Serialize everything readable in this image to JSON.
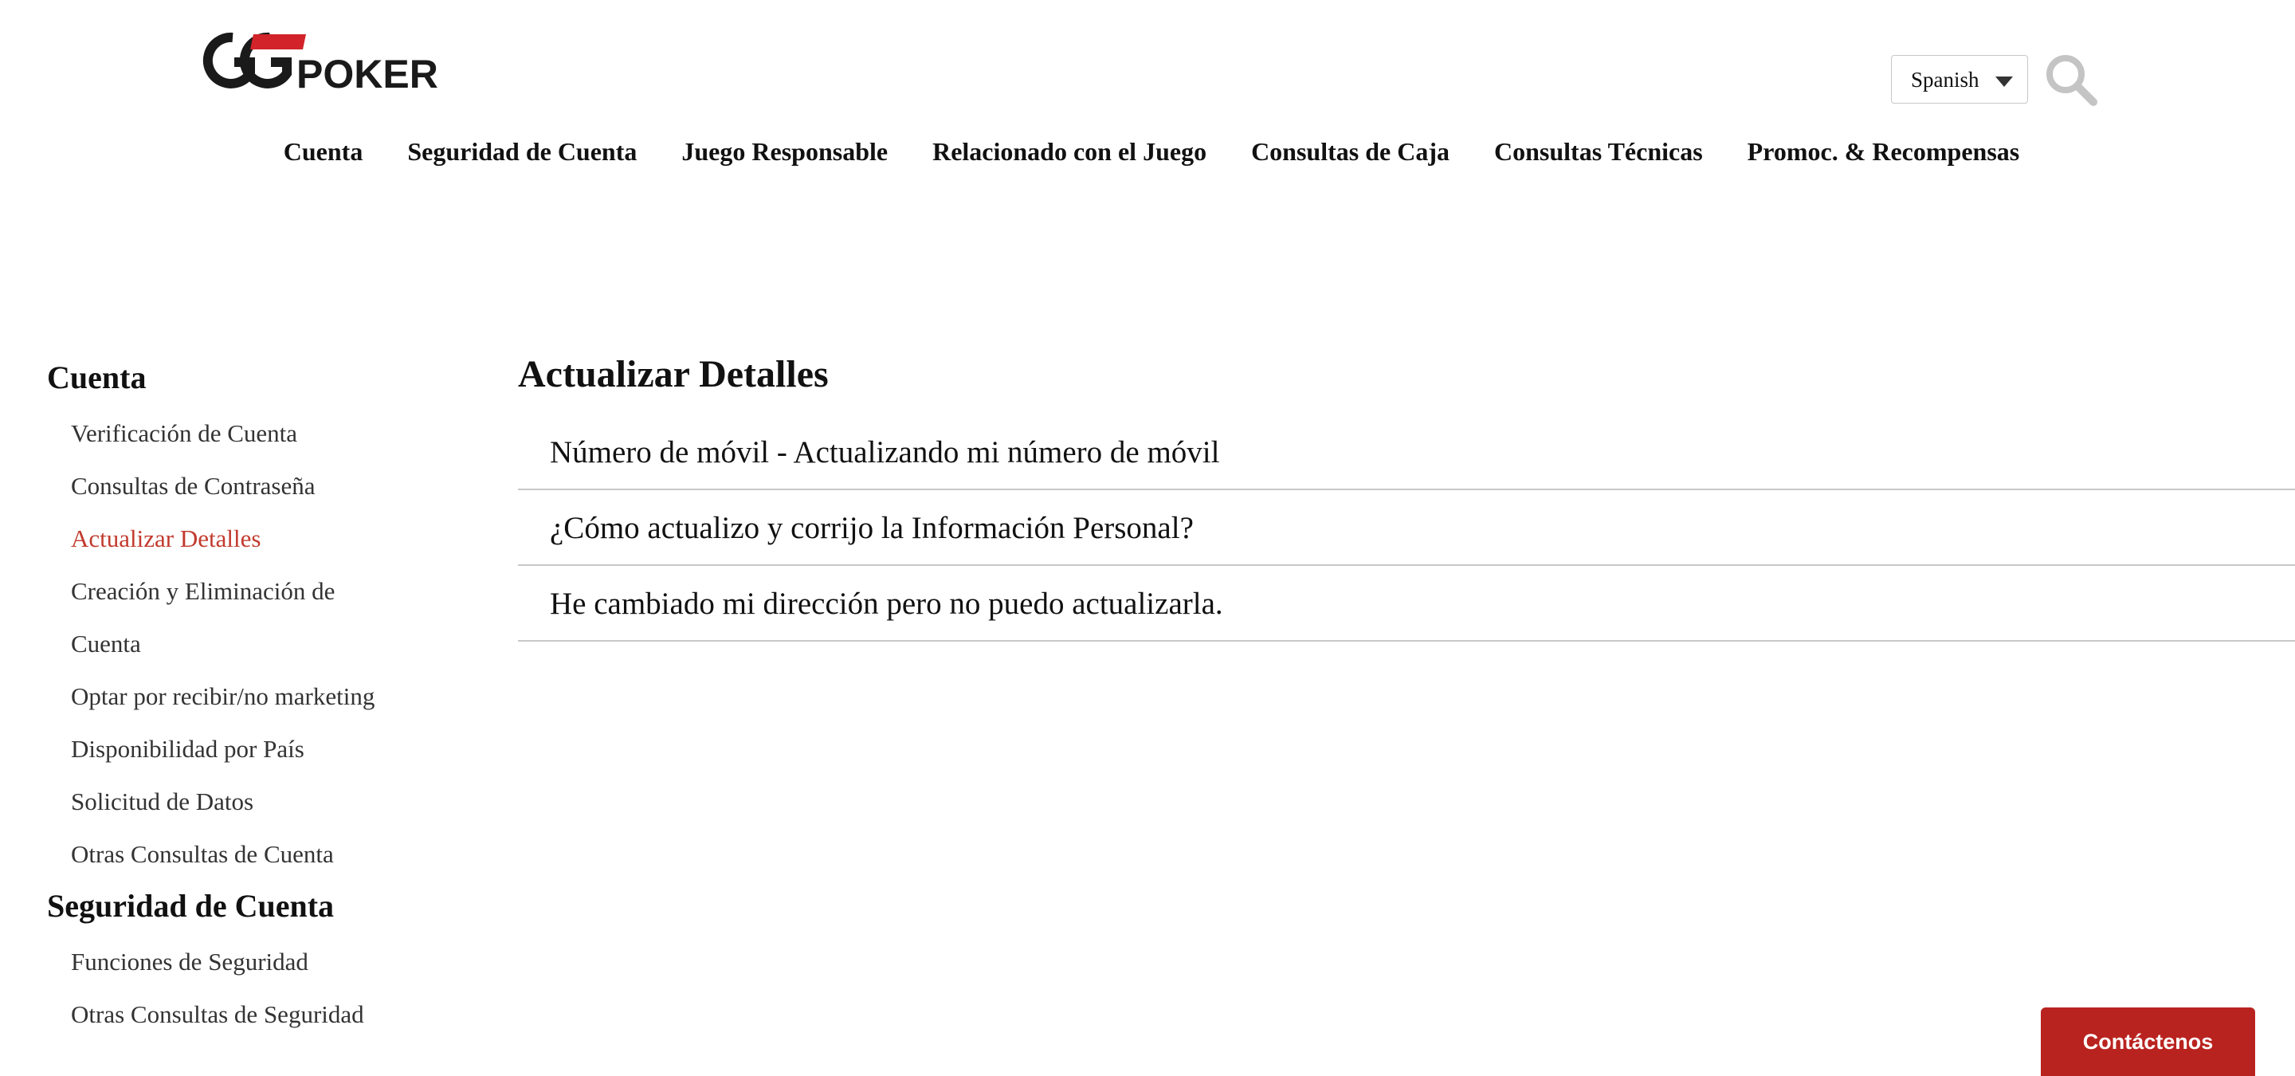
{
  "brand": {
    "logo_text": "GGPOKER",
    "logo_icon": "ggpoker-logo",
    "accent_color": "#c23a2e"
  },
  "header": {
    "language": {
      "selected": "Spanish"
    },
    "search_icon": "search-icon"
  },
  "topnav": {
    "items": [
      {
        "label": "Cuenta"
      },
      {
        "label": "Seguridad de Cuenta"
      },
      {
        "label": "Juego Responsable"
      },
      {
        "label": "Relacionado con el Juego"
      },
      {
        "label": "Consultas de Caja"
      },
      {
        "label": "Consultas Técnicas"
      },
      {
        "label": "Promoc. & Recompensas"
      }
    ]
  },
  "sidebar": {
    "sections": [
      {
        "heading": "Cuenta",
        "items": [
          {
            "label": "Verificación de Cuenta"
          },
          {
            "label": "Consultas de Contraseña"
          },
          {
            "label": "Actualizar Detalles",
            "active": true
          },
          {
            "label": "Creación y Eliminación de"
          },
          {
            "label": "Cuenta"
          },
          {
            "label": "Optar por recibir/no marketing"
          },
          {
            "label": "Disponibilidad por País"
          },
          {
            "label": "Solicitud de Datos"
          },
          {
            "label": "Otras Consultas de Cuenta"
          }
        ]
      },
      {
        "heading": "Seguridad de Cuenta",
        "items": [
          {
            "label": "Funciones de Seguridad"
          },
          {
            "label": "Otras Consultas de Seguridad"
          }
        ]
      }
    ]
  },
  "main": {
    "title": "Actualizar Detalles",
    "articles": [
      {
        "label": "Número de móvil - Actualizando mi número de móvil"
      },
      {
        "label": "¿Cómo actualizo y corrijo la Información Personal?"
      },
      {
        "label": "He cambiado mi dirección pero no puedo actualizarla."
      }
    ]
  },
  "contact": {
    "label": "Contáctenos",
    "color": "#b9231f"
  }
}
